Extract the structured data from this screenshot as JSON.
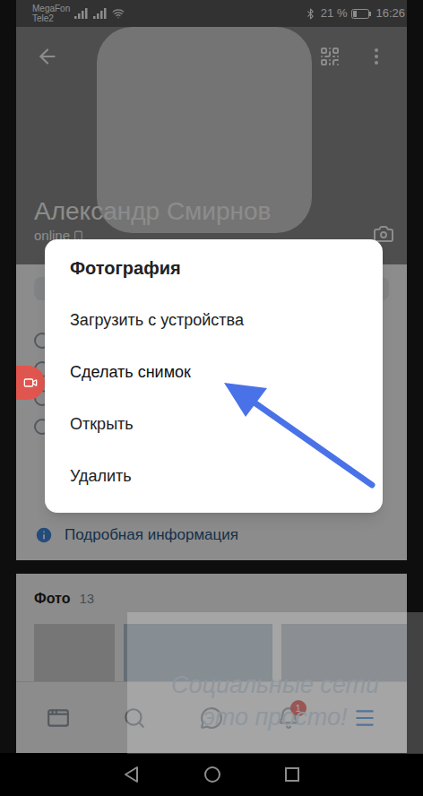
{
  "status_bar": {
    "carriers": [
      "MegaFon",
      "Tele2"
    ],
    "battery": "21 %",
    "time": "16:26"
  },
  "profile": {
    "name": "Александр Смирнов",
    "status": "online",
    "details_link": "Подробная информация"
  },
  "photos": {
    "title": "Фото",
    "count": "13"
  },
  "dialog": {
    "title": "Фотография",
    "items": [
      {
        "label": "Загрузить с устройства",
        "annotated": false
      },
      {
        "label": "Сделать снимок",
        "annotated": true
      },
      {
        "label": "Открыть",
        "annotated": false
      },
      {
        "label": "Удалить",
        "annotated": false
      }
    ]
  },
  "tab_bar": [
    {
      "selected": false,
      "badge": ""
    },
    {
      "selected": false,
      "badge": ""
    },
    {
      "selected": false,
      "badge": ""
    },
    {
      "selected": false,
      "badge": "1"
    },
    {
      "selected": true,
      "badge": ""
    }
  ],
  "watermark": {
    "lines": [
      "Социальные сети",
      "это просто!"
    ]
  }
}
